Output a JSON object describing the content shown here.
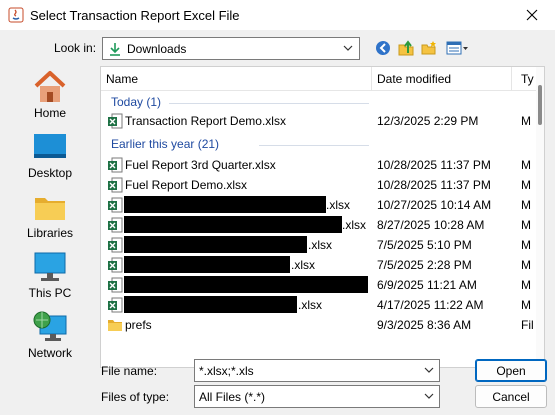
{
  "window": {
    "title": "Select Transaction Report Excel File"
  },
  "lookin": {
    "label": "Look in:",
    "value": "Downloads"
  },
  "places": [
    {
      "label": "Home",
      "icon": "home-icon"
    },
    {
      "label": "Desktop",
      "icon": "desktop-icon"
    },
    {
      "label": "Libraries",
      "icon": "libraries-icon"
    },
    {
      "label": "This PC",
      "icon": "this-pc-icon"
    },
    {
      "label": "Network",
      "icon": "network-icon"
    }
  ],
  "columns": {
    "name": "Name",
    "date": "Date modified",
    "type": "Ty"
  },
  "groups": {
    "today": "Today (1)",
    "earlier": "Earlier this year (21)"
  },
  "files": [
    {
      "name": "Transaction Report Demo.xlsx",
      "date": "12/3/2025 2:29 PM",
      "type": "M"
    },
    {
      "name": "Fuel Report 3rd Quarter.xlsx",
      "date": "10/28/2025 11:37 PM",
      "type": "M"
    },
    {
      "name": "Fuel Report Demo.xlsx",
      "date": "10/28/2025 11:37 PM",
      "type": "M"
    },
    {
      "name": ".xlsx",
      "date": "10/27/2025 10:14 AM",
      "type": "M"
    },
    {
      "name": ".xlsx",
      "date": "8/27/2025 10:28 AM",
      "type": "M"
    },
    {
      "name": ".xlsx",
      "date": "7/5/2025 5:10 PM",
      "type": "M"
    },
    {
      "name": ".xlsx",
      "date": "7/5/2025 2:28 PM",
      "type": "M"
    },
    {
      "name": "",
      "date": "6/9/2025 11:21 AM",
      "type": "M"
    },
    {
      "name": ".xlsx",
      "date": "4/17/2025 11:22 AM",
      "type": "M"
    },
    {
      "name": "prefs",
      "date": "9/3/2025 8:36 AM",
      "type": "Fil"
    }
  ],
  "filename": {
    "label": "File name:",
    "value": "*.xlsx;*.xls"
  },
  "filetype": {
    "label": "Files of type:",
    "value": "All Files (*.*)"
  },
  "buttons": {
    "open": "Open",
    "cancel": "Cancel"
  },
  "colors": {
    "group_text": "#1f4aa0",
    "excel_green": "#1e7145",
    "folder_yellow": "#f5c342",
    "accent": "#0067c0"
  }
}
